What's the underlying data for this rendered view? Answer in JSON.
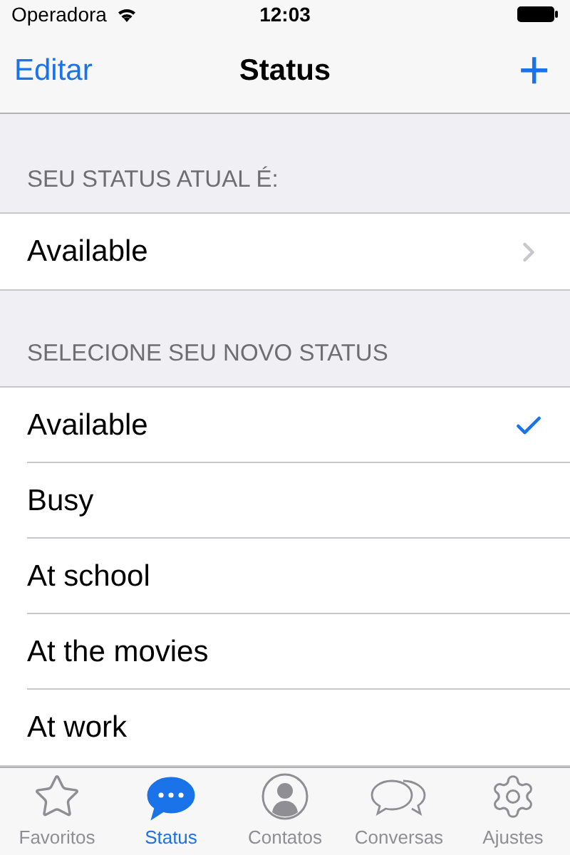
{
  "status_bar": {
    "carrier": "Operadora",
    "time": "12:03"
  },
  "nav": {
    "left": "Editar",
    "title": "Status",
    "right": "+"
  },
  "sections": [
    {
      "header": "SEU STATUS ATUAL É:",
      "items": [
        {
          "kind": "disclosure",
          "label": "Available"
        }
      ]
    },
    {
      "header": "SELECIONE SEU NOVO STATUS",
      "items": [
        {
          "kind": "option",
          "label": "Available",
          "selected": true
        },
        {
          "kind": "option",
          "label": "Busy",
          "selected": false
        },
        {
          "kind": "option",
          "label": "At school",
          "selected": false
        },
        {
          "kind": "option",
          "label": "At the movies",
          "selected": false
        },
        {
          "kind": "option",
          "label": "At work",
          "selected": false
        }
      ]
    }
  ],
  "tabs": [
    {
      "label": "Favoritos",
      "selected": false
    },
    {
      "label": "Status",
      "selected": true
    },
    {
      "label": "Contatos",
      "selected": false
    },
    {
      "label": "Conversas",
      "selected": false
    },
    {
      "label": "Ajustes",
      "selected": false
    }
  ]
}
